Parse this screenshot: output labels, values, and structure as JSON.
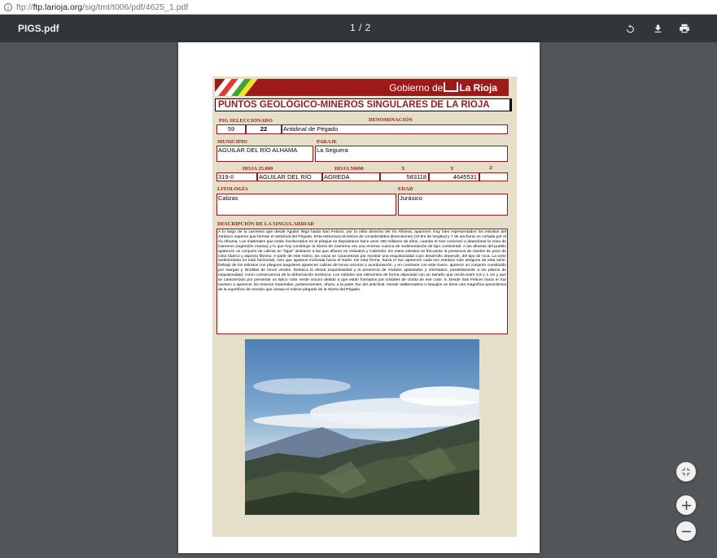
{
  "browser": {
    "url_prefix": "ftp://",
    "url_host": "ftp.larioja.org",
    "url_path": "/sig/tmt/t006/pdf/4625_1.pdf"
  },
  "toolbar": {
    "title": "PIGS.pdf",
    "page_indicator": "1 / 2",
    "icons": [
      "rotate-icon",
      "download-icon",
      "print-icon"
    ]
  },
  "document": {
    "banner": {
      "gobierno_de": "Gobierno de",
      "la_rioja": "La Rioja"
    },
    "title": "PUNTOS GEOLÓGICO-MINEROS SINGULARES DE LA RIOJA",
    "labels": {
      "pig": "PIG SELECCIONADO",
      "denominacion": "DENOMINACIÓN",
      "municipio": "MUNICIPIO",
      "paraje": "PARAJE",
      "hoja25": "HOJA 25.000",
      "hoja50": "HOJA 50000",
      "x": "X",
      "y": "Y",
      "z": "Z",
      "litologia": "LITOLOGÍA",
      "edad": "EDAD",
      "descripcion": "DESCRIPCIÓN DE LA SINGULARIDAD"
    },
    "values": {
      "pig_a": "59",
      "pig_b": "22",
      "denominacion": "Antidinal de Pégado",
      "municipio": "AGUILAR DEL RÍO ALHAMA",
      "paraje": "La Seguera",
      "hoja25_code": "319-II",
      "hoja25_name": "AGUILAR DEL RÍO",
      "hoja50_name": "AGREDA",
      "x": "583118",
      "y": "4645531",
      "z": "",
      "litologia": "Calizas",
      "edad": "Jurásico"
    },
    "description": "A lo largo de la carretera que desde Aguilar llega hasta San Felices, por la orilla derecha del río Alhama, aparecen muy bien representados los estratos del Jurásico superior que forman el anticlinal del Pégado. Esta estructura tectónica de considerables dimensiones (10 km de longitud y 7 de anchura) es cortada por el río Alhama. Los materiales que están involucrados en el pliegue se depositaron hace unos 150 millones de años, cuando el mar comenzó a abandonar la zona de Cameros (regresión marina) y lo que hoy constituye la Sierra de Cameros era una enorme cuenca de sedimentación de tipo continental. A las afueras del pueblo aparecen un conjunto de calizas en \"lajas\" similares a las que afloran en Grávalos y Cabretón. En estos estratos es frecuente la presencia de niveles de yeso de color blanco y aspecto fibroso. A partir de este tramo, las rocas se caracterizan por mostrar una esquistosidad cuyo desarrollo depende, del tipo de roca. La serie sedimentaria no está horizontal, sino que aparece inclinada hacia el Norte. De esta forma, hacia el Sur aparecen cada vez estratos más antiguos de esta serie. Debajo de los estratos con pliegues angulares aparecen calizas de tonos oscuros y acordonación, y en contraste con este tramo, aparece un conjunto constituido por margas y limolitas de tonos verdes. Destaca la densa esquistosidad y la presencia de nódulos aplastados y orientados, paralelamente a los planos de esquistosidad, como consecuencia de la deformación tectónica. Los nódulos son elementos de forma elipsoidal con un tamaño que oscila entre 0,5 y 1 cm y que se caracterizan por presentar un típico color verde oscuro debido a que están formados por cristales de clorita de ese color. 6. Desde San Felices hacia el Sur vuelven a aparecer los mismos materiales, pertenecientes, ahora, a la parte Sur del anticlinal. Desde Valdemadera o Navajún se tiene una magnífica panorámica de la superficie de erosión que arrasa el relieve plegado de la Sierra del Pégado.",
    "banner_stripe_colors": [
      "#ffffff",
      "#e53935",
      "#ffffff",
      "#3fa535",
      "#f2e32b"
    ],
    "photo_description_icon": "mountain-landscape-photo"
  },
  "zoom_controls": {
    "icons": [
      "fit-page-icon",
      "zoom-in-icon",
      "zoom-out-icon"
    ]
  },
  "colors": {
    "toolbar": "#323639",
    "viewer_bg": "#525659",
    "accent_red": "#9e1a1a",
    "sheet_bg": "#e5dfca"
  }
}
